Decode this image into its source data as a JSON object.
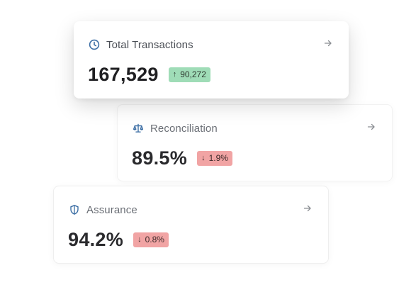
{
  "cards": [
    {
      "label": "Total Transactions",
      "icon": "clock-icon",
      "value": "167,529",
      "change": "90,272",
      "direction": "up",
      "direction_glyph": "↑"
    },
    {
      "label": "Reconciliation",
      "icon": "scale-icon",
      "value": "89.5%",
      "change": "1.9%",
      "direction": "down",
      "direction_glyph": "↓"
    },
    {
      "label": "Assurance",
      "icon": "shield-icon",
      "value": "94.2%",
      "change": "0.8%",
      "direction": "down",
      "direction_glyph": "↓"
    }
  ],
  "colors": {
    "icon_blue": "#3d6fa5",
    "badge_up": "#9fdcb7",
    "badge_down": "#f1a4a4",
    "arrow_gray": "#8a8d92"
  }
}
